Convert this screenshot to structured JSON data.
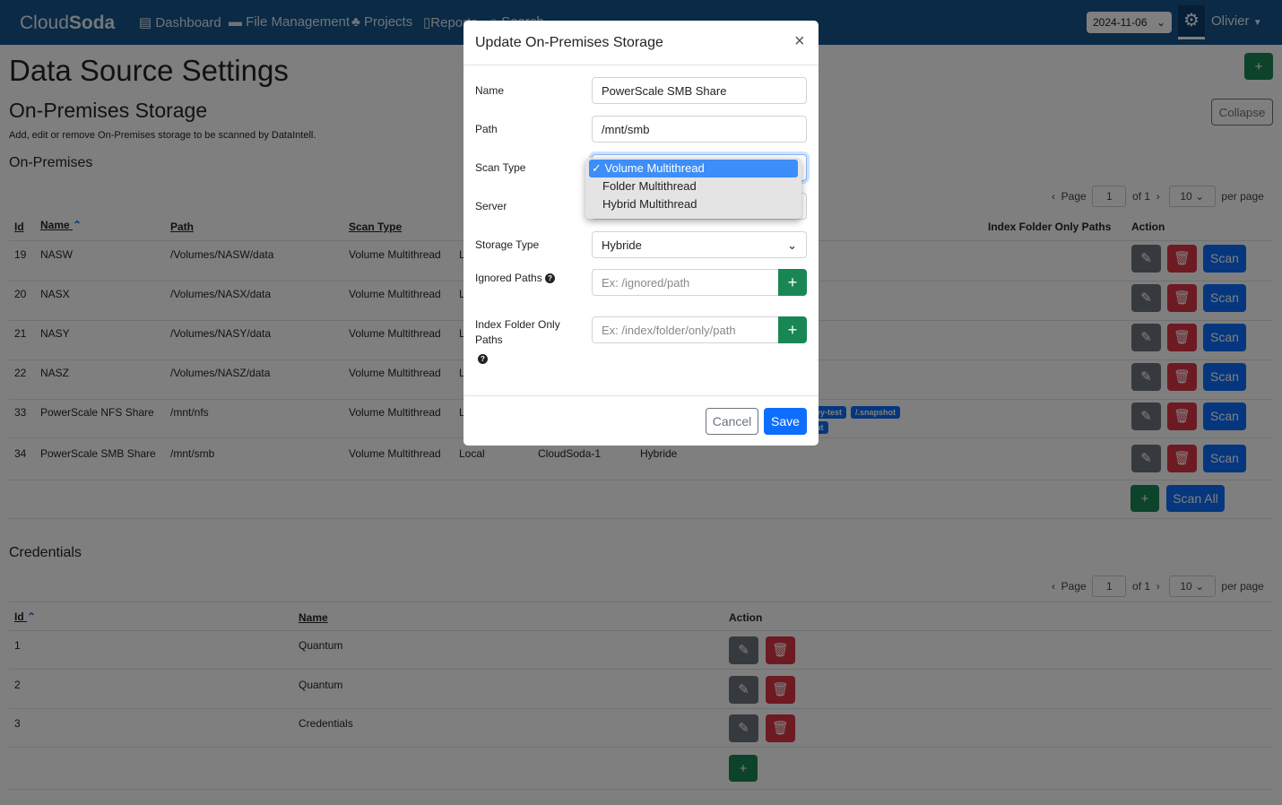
{
  "nav": {
    "brand_light": "Cloud",
    "brand_bold": "Soda",
    "items": [
      "Dashboard",
      "File Management",
      "Projects",
      "Reports",
      "Search"
    ],
    "date": "2024-11-06",
    "user": "Olivier"
  },
  "page": {
    "title": "Data Source Settings",
    "section": "On-Premises Storage",
    "description": "Add, edit or remove On-Premises storage to be scanned by DataIntell.",
    "subsection": "On-Premises",
    "collapse": "Collapse",
    "add": "+"
  },
  "pagination": {
    "page_label": "Page",
    "page": "1",
    "of": "of 1",
    "per_page": "10",
    "per_page_label": "per page"
  },
  "storage_table": {
    "headers": {
      "id": "Id",
      "name": "Name",
      "path": "Path",
      "scan_type": "Scan Type",
      "index_only": "Index Folder Only Paths",
      "action": "Action"
    },
    "rows": [
      {
        "id": "19",
        "name": "NASW",
        "path": "/Volumes/NASW/data",
        "scan_type": "Volume Multithread",
        "mode": "Local"
      },
      {
        "id": "20",
        "name": "NASX",
        "path": "/Volumes/NASX/data",
        "scan_type": "Volume Multithread",
        "mode": "Local"
      },
      {
        "id": "21",
        "name": "NASY",
        "path": "/Volumes/NASY/data",
        "scan_type": "Volume Multithread",
        "mode": "Local"
      },
      {
        "id": "22",
        "name": "NASZ",
        "path": "/Volumes/NASZ/data",
        "scan_type": "Volume Multithread",
        "mode": "Local"
      },
      {
        "id": "33",
        "name": "PowerScale NFS Share",
        "path": "/mnt/nfs",
        "scan_type": "Volume Multithread",
        "mode": "Local",
        "tags": [
          "ey-test",
          "/.snapshot",
          "ut"
        ]
      },
      {
        "id": "34",
        "name": "PowerScale SMB Share",
        "path": "/mnt/smb",
        "scan_type": "Volume Multithread",
        "mode": "Local",
        "server": "CloudSoda-1",
        "storage_type": "Hybride"
      }
    ],
    "scan": "Scan",
    "scan_all": "Scan All"
  },
  "credentials": {
    "title": "Credentials",
    "headers": {
      "id": "Id",
      "name": "Name",
      "action": "Action"
    },
    "rows": [
      {
        "id": "1",
        "name": "Quantum"
      },
      {
        "id": "2",
        "name": "Quantum"
      },
      {
        "id": "3",
        "name": "Credentials"
      }
    ]
  },
  "modal": {
    "title": "Update On-Premises Storage",
    "close": "×",
    "labels": {
      "name": "Name",
      "path": "Path",
      "scan_type": "Scan Type",
      "server": "Server",
      "storage_type": "Storage Type",
      "ignored": "Ignored Paths",
      "index": "Index Folder Only Paths"
    },
    "values": {
      "name": "PowerScale SMB Share",
      "path": "/mnt/smb",
      "storage_type": "Hybride"
    },
    "placeholders": {
      "ignored": "Ex: /ignored/path",
      "index": "Ex: /index/folder/only/path"
    },
    "scan_type_options": [
      "✓ Volume Multithread",
      "Folder Multithread",
      "Hybrid Multithread"
    ],
    "cancel": "Cancel",
    "save": "Save"
  },
  "colors": {
    "navbar": "#14548a",
    "primary": "#0d6efd",
    "success": "#198754",
    "danger": "#dc3545",
    "secondary": "#6c757d"
  }
}
